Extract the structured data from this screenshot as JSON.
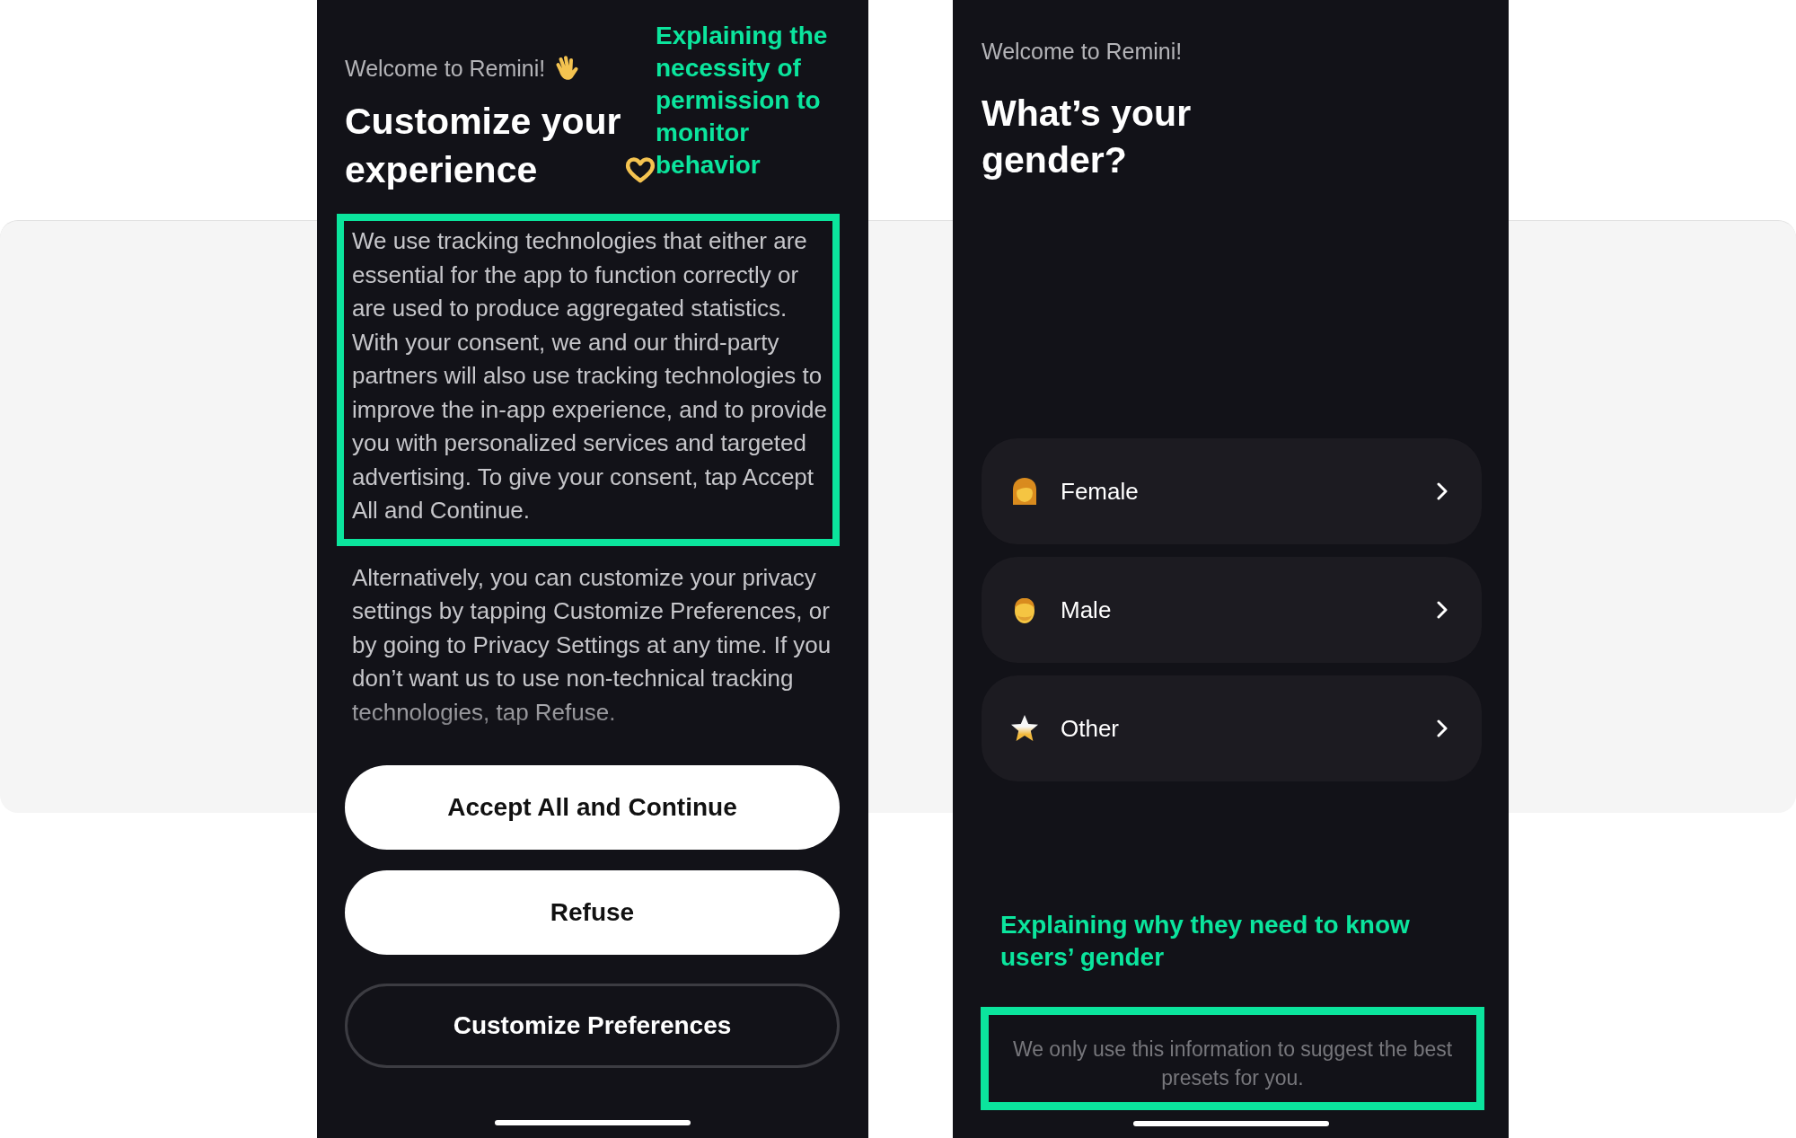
{
  "screens": [
    {
      "kind": "consent",
      "greeting": "Welcome to Remini!",
      "title": "Customize your experience",
      "annotation": "Explaining the necessity of permission to monitor behavior",
      "paragraphs": [
        {
          "text": "We use tracking technologies that either are essential for the app to function correctly or are used to produce aggregated statistics. With your consent, we and our third-party partners will also use tracking technologies to improve the in-app experience, and to provide you with personalized services and targeted advertising. To give your consent, tap Accept All and Continue.",
          "highlighted": true
        },
        {
          "text": "Alternatively, you can customize your privacy settings by tapping Customize Preferences, or by going to Privacy Settings at any time. If you don’t want us to use non-technical tracking technologies, tap Refuse.",
          "highlighted": false
        }
      ],
      "buttons": [
        {
          "label": "Accept All and Continue",
          "kind": "filled"
        },
        {
          "label": "Refuse",
          "kind": "filled"
        },
        {
          "label": "Customize Preferences",
          "kind": "outlined"
        }
      ]
    },
    {
      "kind": "gender",
      "greeting": "Welcome to Remini!",
      "title": "What’s your gender?",
      "options": [
        {
          "label": "Female"
        },
        {
          "label": "Male"
        },
        {
          "label": "Other"
        }
      ],
      "annotation": "Explaining why they need to know users’ gender",
      "note": {
        "text": "We only use this information to suggest the best presets for you.",
        "highlighted": true
      }
    }
  ]
}
